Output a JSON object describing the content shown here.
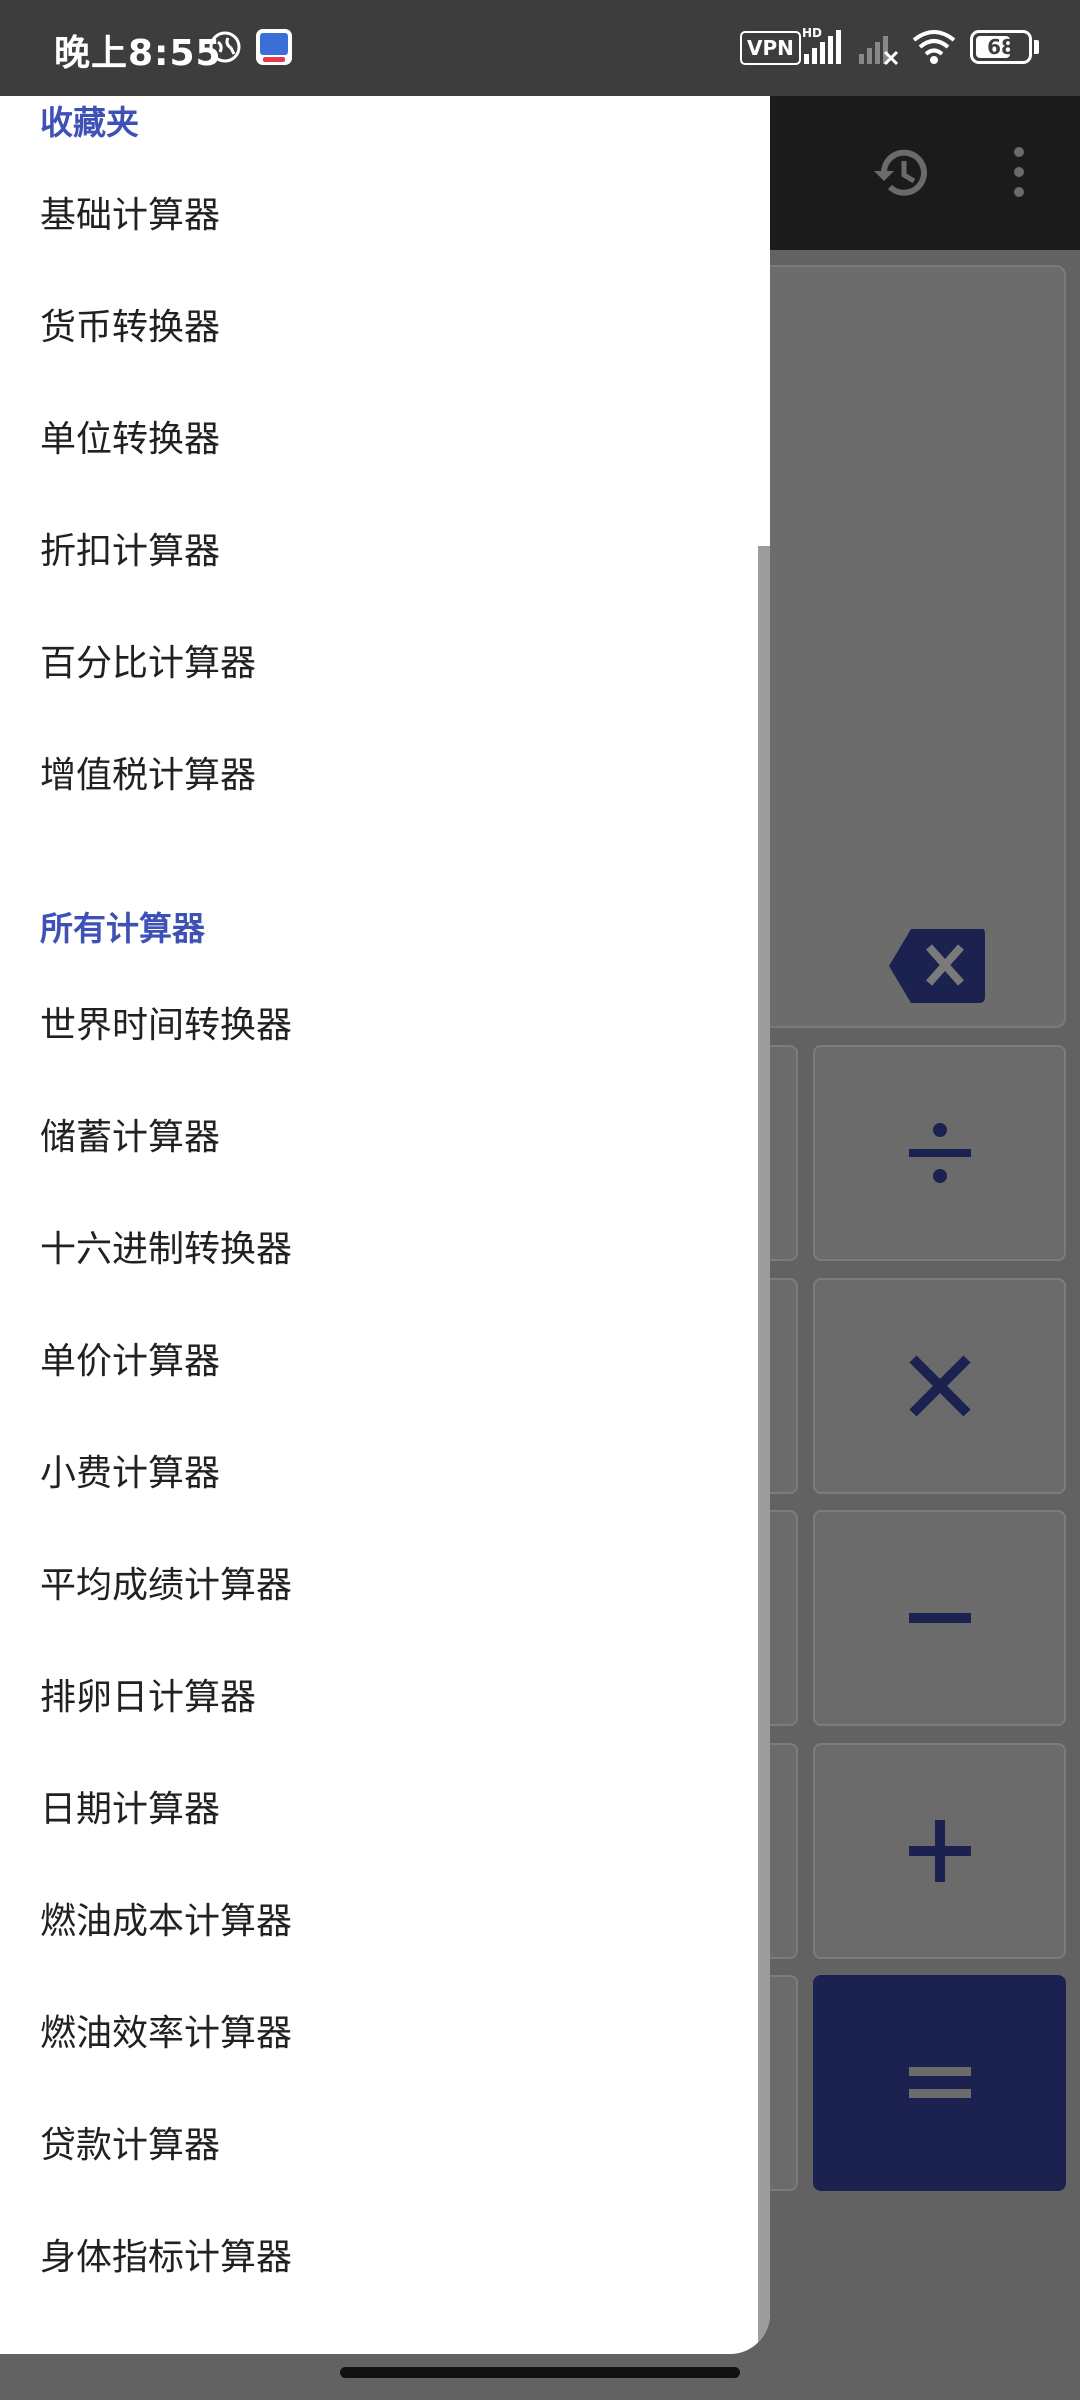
{
  "status_bar": {
    "time": "晚上8:55",
    "vpn": "VPN",
    "network": "HD",
    "battery": "68",
    "battery_level_percent": 68
  },
  "drawer": {
    "favorites_header": "收藏夹",
    "favorites": [
      "基础计算器",
      "货币转换器",
      "单位转换器",
      "折扣计算器",
      "百分比计算器",
      "增值税计算器"
    ],
    "all_header": "所有计算器",
    "all": [
      "世界时间转换器",
      "储蓄计算器",
      "十六进制转换器",
      "单价计算器",
      "小费计算器",
      "平均成绩计算器",
      "排卵日计算器",
      "日期计算器",
      "燃油成本计算器",
      "燃油效率计算器",
      "贷款计算器",
      "身体指标计算器"
    ]
  },
  "app": {
    "toolbar_icons": [
      "history-icon",
      "more-vert-icon"
    ],
    "keys": [
      "÷",
      "×",
      "−",
      "+",
      "="
    ],
    "accent_color": "#1b2250"
  }
}
